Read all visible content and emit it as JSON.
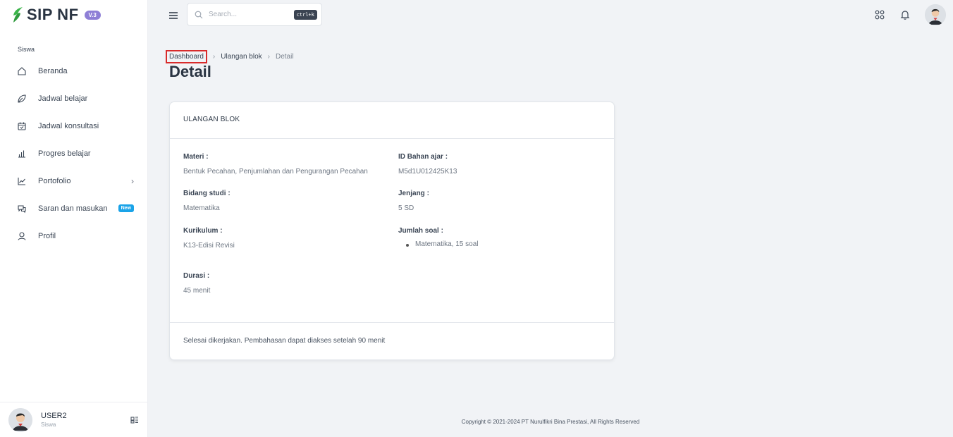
{
  "brand": {
    "name": "SIP NF",
    "version": "V.3"
  },
  "sidebar": {
    "section_label": "Siswa",
    "items": [
      {
        "label": "Beranda",
        "icon": "home-icon"
      },
      {
        "label": "Jadwal belajar",
        "icon": "leaf-icon"
      },
      {
        "label": "Jadwal konsultasi",
        "icon": "calendar-check-icon"
      },
      {
        "label": "Progres belajar",
        "icon": "bar-chart-icon"
      },
      {
        "label": "Portofolio",
        "icon": "line-chart-icon",
        "has_submenu": true
      },
      {
        "label": "Saran dan masukan",
        "icon": "chat-bubbles-icon",
        "badge": "New"
      },
      {
        "label": "Profil",
        "icon": "user-icon"
      }
    ],
    "user": {
      "name": "USER2",
      "role": "Siswa"
    }
  },
  "topbar": {
    "search_placeholder": "Search...",
    "shortcut": "ctrl+k"
  },
  "breadcrumb": {
    "items": [
      "Dashboard",
      "Ulangan blok",
      "Detail"
    ]
  },
  "page": {
    "title": "Detail"
  },
  "card": {
    "header": "ULANGAN BLOK",
    "fields": {
      "materi_label": "Materi :",
      "materi_value": "Bentuk Pecahan, Penjumlahan dan Pengurangan Pecahan",
      "id_label": "ID Bahan ajar :",
      "id_value": "M5d1U012425K13",
      "bidang_label": "Bidang studi :",
      "bidang_value": "Matematika",
      "jenjang_label": "Jenjang :",
      "jenjang_value": "5 SD",
      "kurikulum_label": "Kurikulum :",
      "kurikulum_value": "K13-Edisi Revisi",
      "jumlah_label": "Jumlah soal :",
      "jumlah_items": [
        "Matematika, 15 soal"
      ],
      "durasi_label": "Durasi :",
      "durasi_value": "45 menit"
    },
    "footer": "Selesai dikerjakan. Pembahasan dapat diakses setelah 90 menit"
  },
  "footer": {
    "copyright": "Copyright © 2021-2024 PT Nurulfikri Bina Prestasi, All Rights Reserved"
  },
  "colors": {
    "accent_purple": "#8e7fd6",
    "badge_blue": "#1aa3e8",
    "logo_green": "#3bb54a",
    "highlight_red": "#d82b2b"
  }
}
